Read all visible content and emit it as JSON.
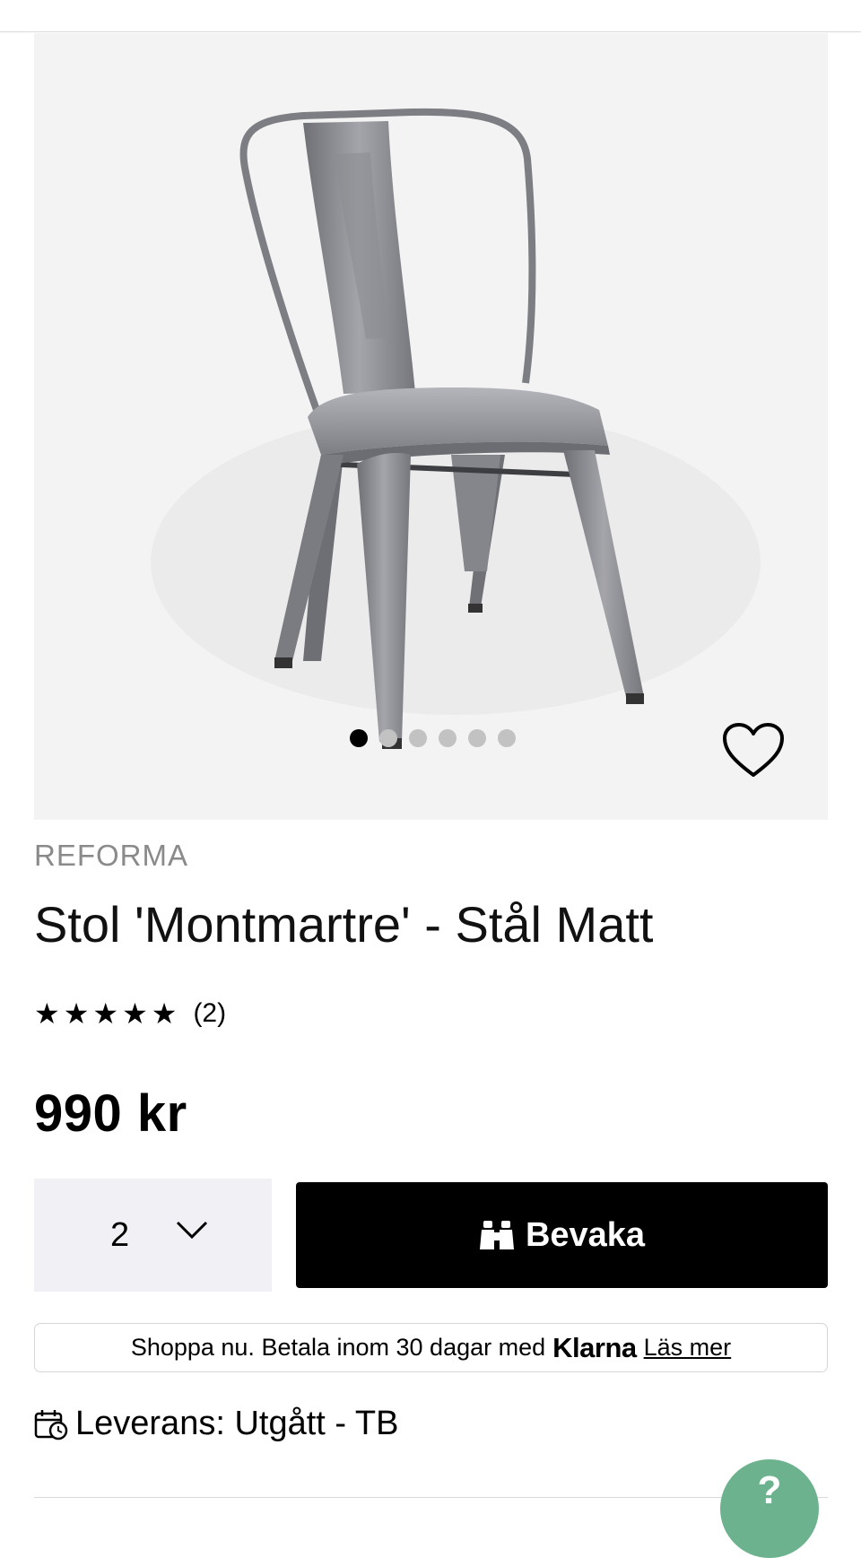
{
  "product": {
    "brand": "REFORMA",
    "title": "Stol 'Montmartre' - Stål Matt",
    "rating": {
      "stars": "★★★★★",
      "value": 5,
      "max": 5,
      "count_label": "(2)"
    },
    "price": "990 kr",
    "image_count": 6,
    "active_image": 1
  },
  "quantity": {
    "value": "2"
  },
  "actions": {
    "watch_label": "Bevaka"
  },
  "klarna": {
    "text": "Shoppa nu. Betala inom 30 dagar med",
    "logo": "Klarna",
    "link": "Läs mer"
  },
  "delivery": {
    "label": "Leverans: Utgått - TB"
  },
  "help": {
    "glyph": "?"
  },
  "icons": [
    "heart-icon",
    "chevron-down-icon",
    "binoculars-icon",
    "calendar-clock-icon",
    "help-icon"
  ],
  "colors": {
    "accent_button": "#000000",
    "help_button": "#6db28e",
    "brand_text": "#8a8a8a"
  }
}
